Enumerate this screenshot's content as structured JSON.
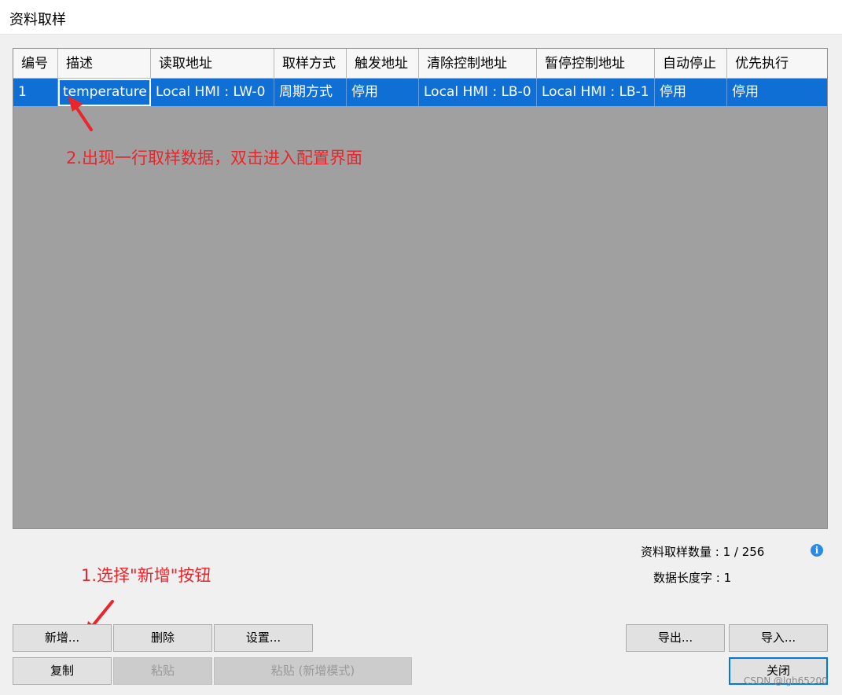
{
  "window": {
    "title": "资料取样"
  },
  "table": {
    "columns": [
      "编号",
      "描述",
      "读取地址",
      "取样方式",
      "触发地址",
      "清除控制地址",
      "暂停控制地址",
      "自动停止",
      "优先执行"
    ],
    "rows": [
      [
        "1",
        "temperature",
        "Local HMI : LW-0",
        "周期方式",
        "停用",
        "Local HMI : LB-0",
        "Local HMI : LB-1",
        "停用",
        "停用"
      ]
    ]
  },
  "annotations": {
    "step2": "2.出现一行取样数据，双击进入配置界面",
    "step1": "1.选择\"新增\"按钮"
  },
  "info": {
    "sample_count": "资料取样数量 : 1 / 256",
    "data_length": "数据长度字 : 1"
  },
  "buttons": {
    "add": "新增...",
    "delete": "删除",
    "settings": "设置...",
    "copy": "复制",
    "paste": "粘贴",
    "paste_new": "粘贴 (新增模式)",
    "export": "导出...",
    "import": "导入...",
    "close": "关闭"
  },
  "watermark": "CSDN @lgh65200",
  "colors": {
    "selection": "#0f6fd5",
    "annotation": "#e8262c",
    "grid_bg": "#a0a0a0"
  }
}
